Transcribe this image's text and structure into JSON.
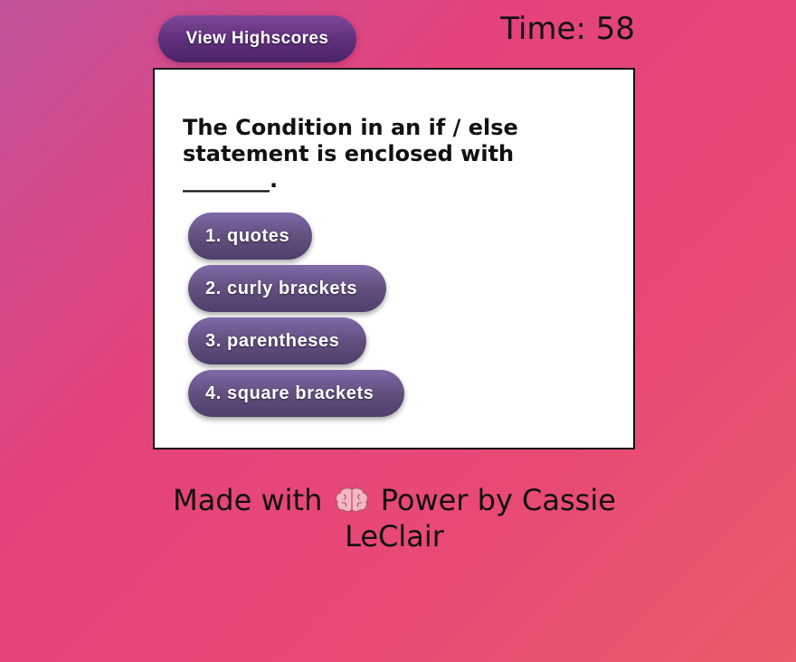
{
  "header": {
    "highscores_label": "View Highscores",
    "timer_text": "Time: 58"
  },
  "quiz": {
    "question": "The Condition in an if / else statement is enclosed with ________.",
    "answers": [
      {
        "label": "1. quotes"
      },
      {
        "label": "2. curly brackets"
      },
      {
        "label": "3. parentheses"
      },
      {
        "label": "4. square brackets"
      }
    ]
  },
  "footer": {
    "prefix": "Made with",
    "icon": "brain-icon",
    "suffix": "Power by Cassie LeClair"
  },
  "colors": {
    "background_start": "#c2549a",
    "background_end": "#e95a6a",
    "button_purple": "#5e2f7a",
    "answer_purple": "#63507f"
  }
}
